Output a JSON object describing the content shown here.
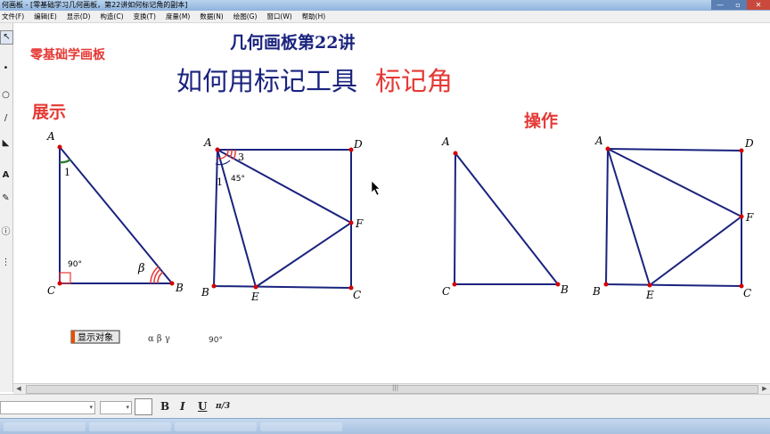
{
  "window": {
    "title": "何画板 - [零基础学习几何画板，第22讲如何标记角的副本]",
    "controls": [
      "—",
      "▫",
      "✕"
    ]
  },
  "menu": {
    "items": [
      "文件(F)",
      "编辑(E)",
      "显示(D)",
      "构造(C)",
      "变换(T)",
      "度量(M)",
      "数据(N)",
      "绘图(G)",
      "窗口(W)",
      "帮助(H)"
    ]
  },
  "toolbox": {
    "icons": [
      "arrow-select-icon",
      "point-icon",
      "compass-icon",
      "line-icon",
      "polygon-icon",
      "text-icon",
      "marker-icon",
      "info-icon",
      "custom-tool-icon"
    ]
  },
  "canvas": {
    "brand": "零基础学画板",
    "lesson_title": "几何画板第22讲",
    "main_title_part1": "如何用标记工具",
    "main_title_part2": "标记角",
    "section_demo": "展示",
    "section_operate": "操作",
    "show_objects_button": "显示对象",
    "greek_labels": "α β γ",
    "degree_label": "90°",
    "fig1": {
      "A": "A",
      "B": "B",
      "C": "C",
      "angle1": "1",
      "right": "90°",
      "beta": "β"
    },
    "fig2": {
      "A": "A",
      "B": "B",
      "C": "C",
      "D": "D",
      "E": "E",
      "F": "F",
      "angle1": "1",
      "angle3": "3",
      "deg45": "45°"
    },
    "fig3": {
      "A": "A",
      "B": "B",
      "C": "C"
    },
    "fig4": {
      "A": "A",
      "B": "B",
      "C": "C",
      "D": "D",
      "E": "E",
      "F": "F"
    }
  },
  "textbar": {
    "bold": "B",
    "italic": "I",
    "underline": "U",
    "math_format": "π/3"
  },
  "colors": {
    "line": "#1a237e",
    "point": "#d50000",
    "title_blue": "#1a237e",
    "accent_red": "#e53935"
  }
}
